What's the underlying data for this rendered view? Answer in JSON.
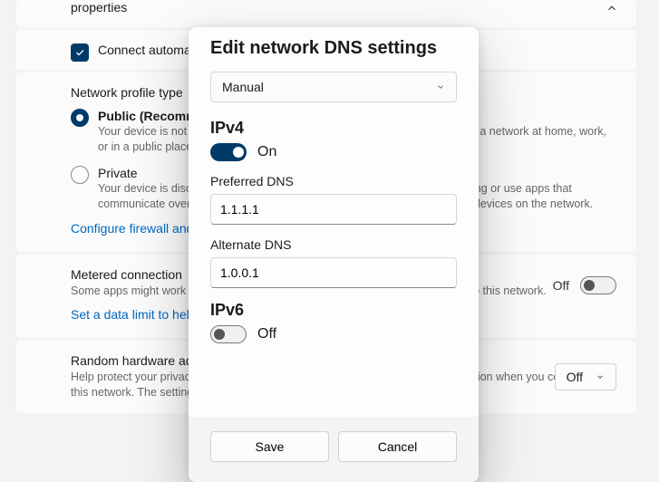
{
  "bg": {
    "properties_title": "properties",
    "connect_auto": "Connect automatically",
    "profile": {
      "heading": "Network profile type",
      "public_title": "Public (Recommended)",
      "public_desc": "Your device is not discoverable on the network. Use this when connected to a network at home, work, or in a public place.",
      "private_title": "Private",
      "private_desc": "Your device is discoverable on the network. Select this if you need file sharing or use apps that communicate over this network. You should know and trust the people and devices on the network.",
      "firewall_link": "Configure firewall and security settings"
    },
    "metered": {
      "title": "Metered connection",
      "desc": "Some apps might work differently to reduce data usage when you're connected to this network.",
      "link": "Set a data limit to help control data usage on this network",
      "state": "Off"
    },
    "random_mac": {
      "title": "Random hardware addresses",
      "desc": "Help protect your privacy by making it harder for people to track your device location when you connect to this network. The setting applies only to this network.",
      "state": "Off"
    }
  },
  "modal": {
    "title": "Edit network DNS settings",
    "mode": "Manual",
    "ipv4": {
      "heading": "IPv4",
      "state": "On",
      "preferred_label": "Preferred DNS",
      "preferred_value": "1.1.1.1",
      "alternate_label": "Alternate DNS",
      "alternate_value": "1.0.0.1"
    },
    "ipv6": {
      "heading": "IPv6",
      "state": "Off"
    },
    "save": "Save",
    "cancel": "Cancel"
  }
}
